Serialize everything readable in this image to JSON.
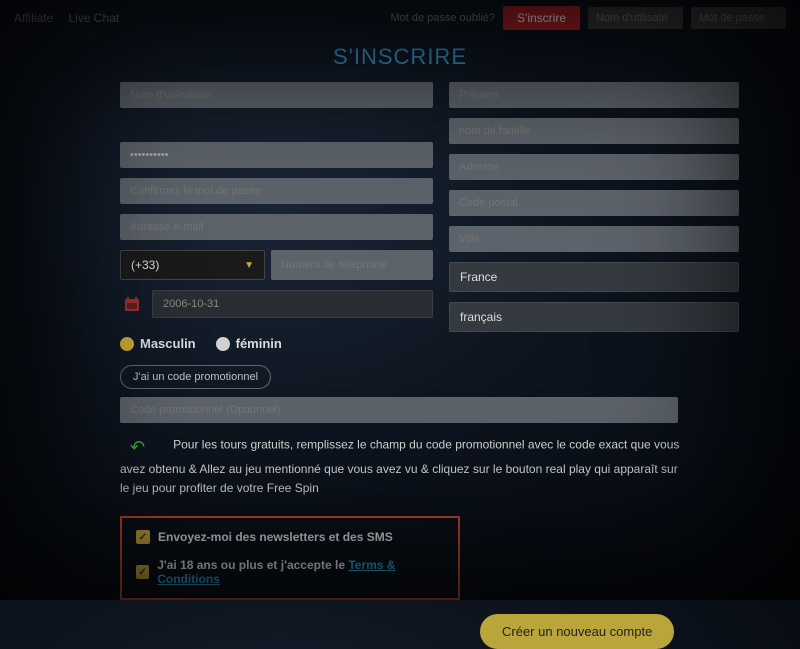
{
  "nav": {
    "affiliate": "Affiliate",
    "live_chat": "Live Chat",
    "forgot": "Mot de passe oublié?",
    "signup": "S'inscrire",
    "username_ph": "Nom d'utilisate",
    "password_ph": "Mot de passe"
  },
  "title": "S'INSCRIRE",
  "left": {
    "username": "Nom d'utilisateur",
    "password_dots": "••••••••••",
    "confirm": "Confirmez le mot de passe",
    "email": "Adresse e-mail",
    "phone_code": "(+33)",
    "phone_ph": "Numéro de téléphone",
    "dob": "2006-10-31"
  },
  "right": {
    "firstname": "Prénom",
    "lastname": "nom de famille",
    "address": "Adresse",
    "zip": "Code postal",
    "city": "Ville",
    "country": "France",
    "language": "français"
  },
  "gender": {
    "male": "Masculin",
    "female": "féminin"
  },
  "promo": {
    "btn": "J'ai un code promotionnel",
    "field_ph": "Code promotionnel (Optionnel)"
  },
  "hint": "Pour les tours gratuits, remplissez le champ du code promotionnel avec le code exact que vous avez obtenu & Allez au jeu mentionné que vous avez vu & cliquez sur le bouton real play qui apparaît sur le jeu pour profiter de votre Free Spin",
  "consent": {
    "news": "Envoyez-moi des newsletters et des SMS",
    "age_pre": "J'ai 18 ans ou plus et j'accepte le ",
    "tc": "Terms & Conditions"
  },
  "submit": "Créer un nouveau compte"
}
